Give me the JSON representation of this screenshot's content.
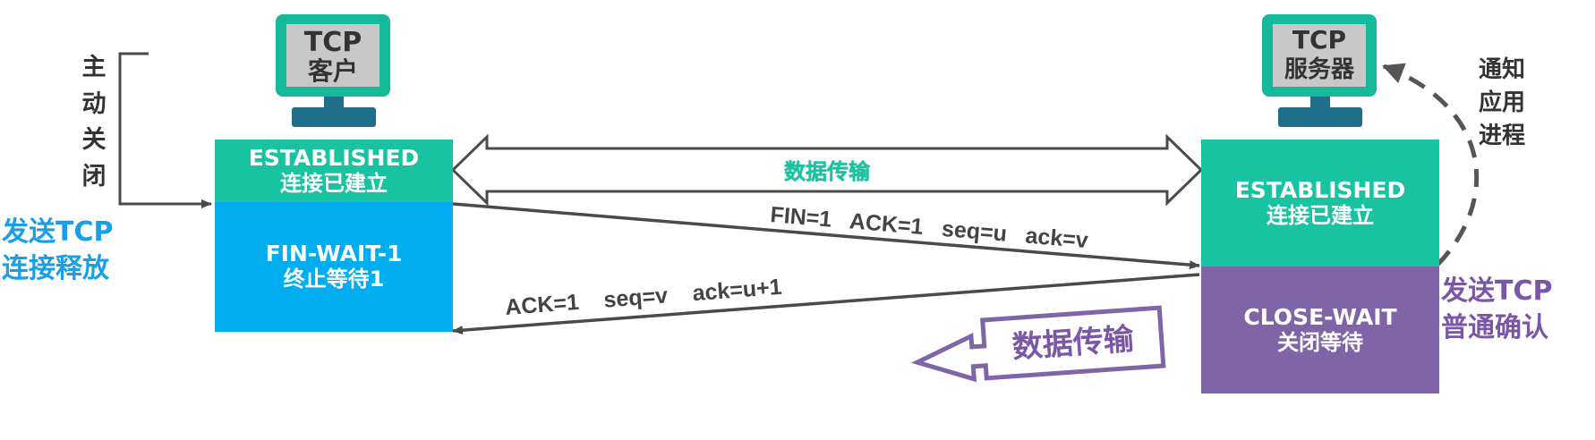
{
  "client": {
    "computer_line1": "TCP",
    "computer_line2": "客户",
    "state1_line1": "ESTABLISHED",
    "state1_line2": "连接已建立",
    "state2_line1": "FIN-WAIT-1",
    "state2_line2": "终止等待1",
    "left_label_chars": [
      "主",
      "动",
      "关",
      "闭"
    ],
    "send_label_line1": "发送TCP",
    "send_label_line2": "连接释放"
  },
  "server": {
    "computer_line1": "TCP",
    "computer_line2": "服务器",
    "state1_line1": "ESTABLISHED",
    "state1_line2": "连接已建立",
    "state2_line1": "CLOSE-WAIT",
    "state2_line2": "关闭等待",
    "notify_line1": "通知",
    "notify_line2": "应用",
    "notify_line3": "进程",
    "send_label_line1": "发送TCP",
    "send_label_line2": "普通确认"
  },
  "messages": {
    "data_transfer": "数据传输",
    "fin_segment": "FIN=1   ACK=1   seq=u   ack=v",
    "ack_segment": "ACK=1    seq=v    ack=u+1",
    "server_data_transfer": "数据传输"
  },
  "colors": {
    "teal": "#17c3a0",
    "blue": "#00aeef",
    "purple": "#8064a8",
    "computer_frame": "#16b99a",
    "computer_screen": "#c8c8c8",
    "computer_stand": "#1f6f8b",
    "arrow": "#4a4a4a",
    "label_blue": "#1a9fe6",
    "label_purple": "#7a55a8"
  }
}
